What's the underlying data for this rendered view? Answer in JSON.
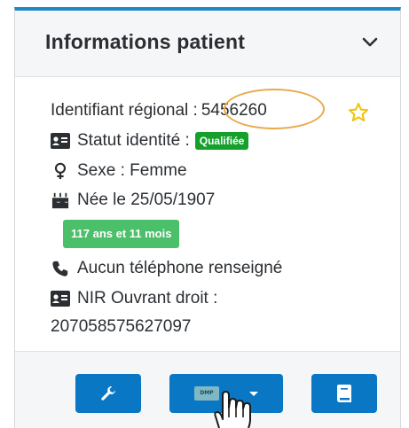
{
  "header": {
    "title": "Informations patient",
    "collapse_icon": "chevron-down-icon"
  },
  "patient": {
    "regional_id_label": "Identifiant régional :",
    "regional_id_value": "5456260",
    "identity_status_label": "Statut identité :",
    "identity_status_badge": "Qualifiée",
    "sex": "Sexe : Femme",
    "birth": "Née le 25/05/1907",
    "age_badge": "117 ans et 11 mois",
    "phone": "Aucun téléphone renseigné",
    "nir_label": "NIR Ouvrant droit :",
    "nir_value": "207058575627097"
  },
  "footer": {
    "dmp_label": "DMP"
  },
  "colors": {
    "accent": "#0a77c4",
    "header_border": "#1e88c9",
    "badge_green": "#14a02a",
    "age_badge_green": "#4cbf6b",
    "highlight_oval": "#e9a94b",
    "star": "#f2c200"
  }
}
